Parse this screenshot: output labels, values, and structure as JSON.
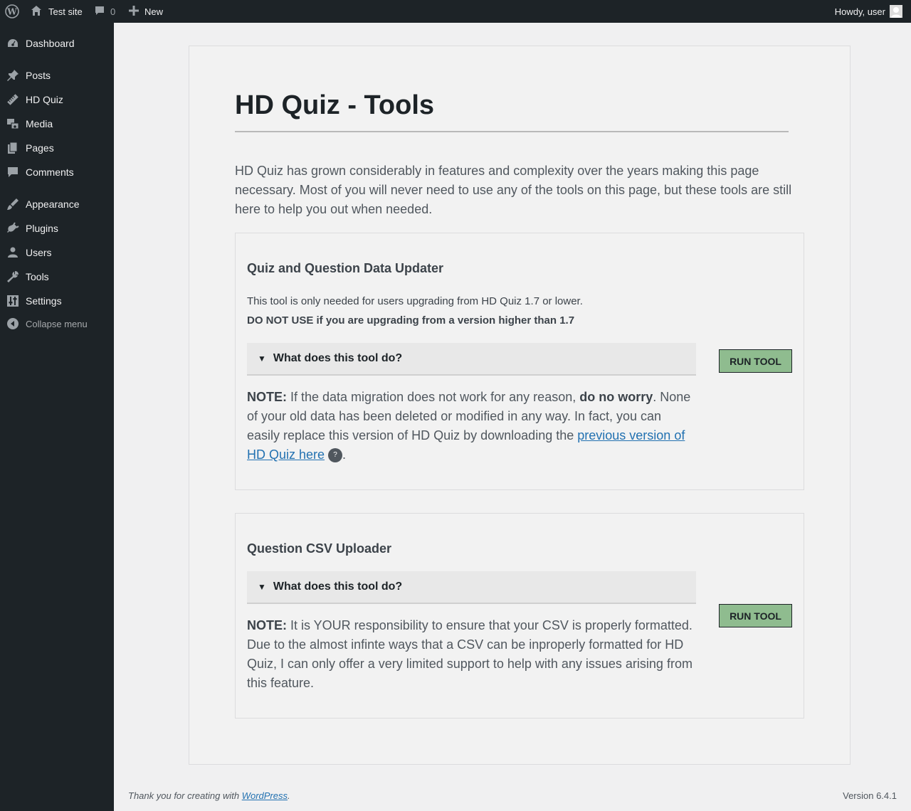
{
  "adminbar": {
    "site_name": "Test site",
    "comments_count": "0",
    "new_label": "New",
    "howdy": "Howdy, user"
  },
  "sidebar": {
    "items": [
      {
        "label": "Dashboard",
        "icon": "dashboard-icon"
      },
      {
        "label": "Posts",
        "icon": "pin-icon"
      },
      {
        "label": "HD Quiz",
        "icon": "ruler-icon"
      },
      {
        "label": "Media",
        "icon": "media-icon"
      },
      {
        "label": "Pages",
        "icon": "pages-icon"
      },
      {
        "label": "Comments",
        "icon": "comment-icon"
      },
      {
        "label": "Appearance",
        "icon": "brush-icon"
      },
      {
        "label": "Plugins",
        "icon": "plug-icon"
      },
      {
        "label": "Users",
        "icon": "user-icon"
      },
      {
        "label": "Tools",
        "icon": "wrench-icon"
      },
      {
        "label": "Settings",
        "icon": "sliders-icon"
      }
    ],
    "collapse_label": "Collapse menu"
  },
  "main": {
    "title": "HD Quiz - Tools",
    "intro": "HD Quiz has grown considerably in features and complexity over the years making this page necessary. Most of you will never need to use any of the tools on this page, but these tools are still here to help you out when needed.",
    "tools": [
      {
        "title": "Quiz and Question Data Updater",
        "subtitle": "This tool is only needed for users upgrading from HD Quiz 1.7 or lower.",
        "warning": "DO NOT USE if you are upgrading from a version higher than 1.7",
        "details_label": "What does this tool do?",
        "note_label": "NOTE:",
        "note_part1": " If the data migration does not work for any reason, ",
        "note_bold": "do no worry",
        "note_part2": ". None of your old data has been deleted or modified in any way. In fact, you can easily replace this version of HD Quiz by downloading the ",
        "note_link": "previous version of HD Quiz here",
        "qmark": "?",
        "note_end": ".",
        "button": "RUN TOOL"
      },
      {
        "title": "Question CSV Uploader",
        "details_label": "What does this tool do?",
        "note_label": "NOTE:",
        "note_text": " It is YOUR responsibility to ensure that your CSV is properly formatted. Due to the almost infinte ways that a CSV can be inproperly formatted for HD Quiz, I can only offer a very limited support to help with any issues arising from this feature.",
        "button": "RUN TOOL"
      }
    ]
  },
  "footer": {
    "thanks_prefix": "Thank you for creating with ",
    "thanks_link": "WordPress",
    "thanks_suffix": ".",
    "version": "Version 6.4.1"
  }
}
